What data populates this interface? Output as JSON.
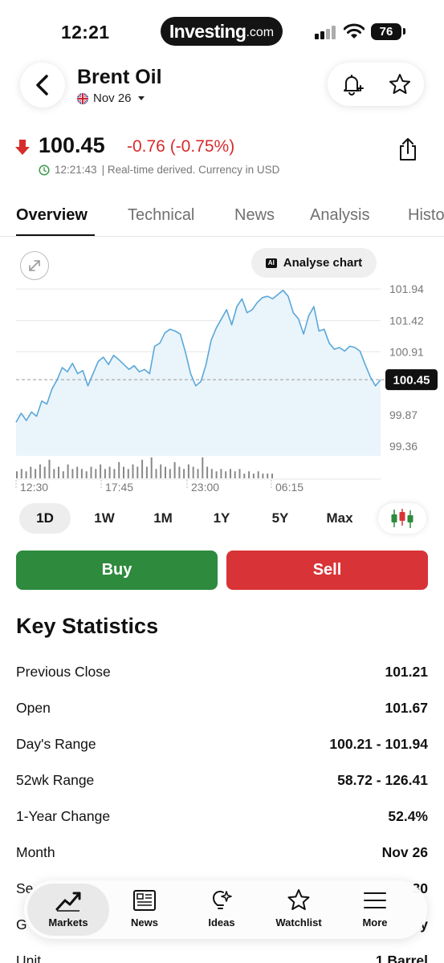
{
  "status_bar": {
    "time": "12:21",
    "brand": "Investing",
    "brand_suffix": ".com",
    "battery": "76"
  },
  "header": {
    "title": "Brent Oil",
    "contract": "Nov 26"
  },
  "quote": {
    "price": "100.45",
    "change": "-0.76 (-0.75%)",
    "time": "12:21:43",
    "realtime_note": "| Real-time derived. Currency in USD",
    "direction": "down"
  },
  "tabs": [
    {
      "label": "Overview",
      "active": true
    },
    {
      "label": "Technical"
    },
    {
      "label": "News"
    },
    {
      "label": "Analysis"
    },
    {
      "label": "Histo"
    }
  ],
  "chart_controls": {
    "analyse_label": "Analyse chart",
    "ai_badge": "AI"
  },
  "chart_data": {
    "type": "area",
    "x_ticks": [
      "12:30",
      "17:45",
      "23:00",
      "06:15"
    ],
    "y_ticks": [
      101.94,
      101.42,
      100.91,
      99.87,
      99.36
    ],
    "ylim": [
      99.2,
      102.1
    ],
    "current_value": 100.45,
    "current_label": "100.45",
    "values": [
      99.75,
      99.9,
      99.78,
      99.92,
      99.85,
      100.1,
      100.05,
      100.3,
      100.45,
      100.65,
      100.58,
      100.72,
      100.55,
      100.6,
      100.35,
      100.55,
      100.75,
      100.82,
      100.7,
      100.85,
      100.78,
      100.7,
      100.62,
      100.68,
      100.58,
      100.62,
      100.55,
      101.0,
      101.05,
      101.22,
      101.28,
      101.25,
      101.2,
      100.9,
      100.55,
      100.35,
      100.42,
      100.7,
      101.1,
      101.3,
      101.45,
      101.6,
      101.35,
      101.65,
      101.78,
      101.55,
      101.6,
      101.72,
      101.8,
      101.82,
      101.78,
      101.85,
      101.92,
      101.82,
      101.55,
      101.45,
      101.2,
      101.5,
      101.65,
      101.25,
      101.28,
      101.05,
      100.95,
      100.98,
      100.92,
      101.0,
      100.98,
      100.92,
      100.7,
      100.5,
      100.35,
      100.45
    ],
    "volumes": [
      3,
      4,
      3,
      5,
      4,
      6,
      5,
      8,
      4,
      5,
      3,
      6,
      4,
      5,
      4,
      3,
      5,
      4,
      6,
      4,
      5,
      4,
      7,
      5,
      4,
      6,
      5,
      8,
      5,
      9,
      4,
      6,
      5,
      4,
      7,
      5,
      4,
      6,
      5,
      4,
      9,
      5,
      4,
      3,
      4,
      3,
      4,
      3,
      4,
      2,
      3,
      2,
      3,
      2,
      2,
      2
    ]
  },
  "timeframes": [
    "1D",
    "1W",
    "1M",
    "1Y",
    "5Y",
    "Max"
  ],
  "active_timeframe": "1D",
  "trade": {
    "buy": "Buy",
    "sell": "Sell"
  },
  "key_statistics": {
    "title": "Key Statistics",
    "rows": [
      {
        "label": "Previous Close",
        "value": "101.21"
      },
      {
        "label": "Open",
        "value": "101.67"
      },
      {
        "label": "Day's Range",
        "value": "100.21 - 101.94"
      },
      {
        "label": "52wk Range",
        "value": "58.72 - 126.41"
      },
      {
        "label": "1-Year Change",
        "value": "52.4%"
      },
      {
        "label": "Month",
        "value": "Nov 26"
      },
      {
        "label": "Se",
        "value": "30"
      },
      {
        "label": "G",
        "value": "y"
      },
      {
        "label": "Unit",
        "value": "1 Barrel"
      }
    ]
  },
  "bottom_nav": [
    {
      "label": "Markets",
      "icon": "chart-trend-icon",
      "active": true
    },
    {
      "label": "News",
      "icon": "newspaper-icon"
    },
    {
      "label": "Ideas",
      "icon": "lightbulb-icon"
    },
    {
      "label": "Watchlist",
      "icon": "star-icon"
    },
    {
      "label": "More",
      "icon": "menu-icon"
    }
  ],
  "colors": {
    "accent_line": "#5aa8d8",
    "negative": "#d62c2c",
    "buy": "#2e8a3d",
    "sell": "#d83437"
  }
}
